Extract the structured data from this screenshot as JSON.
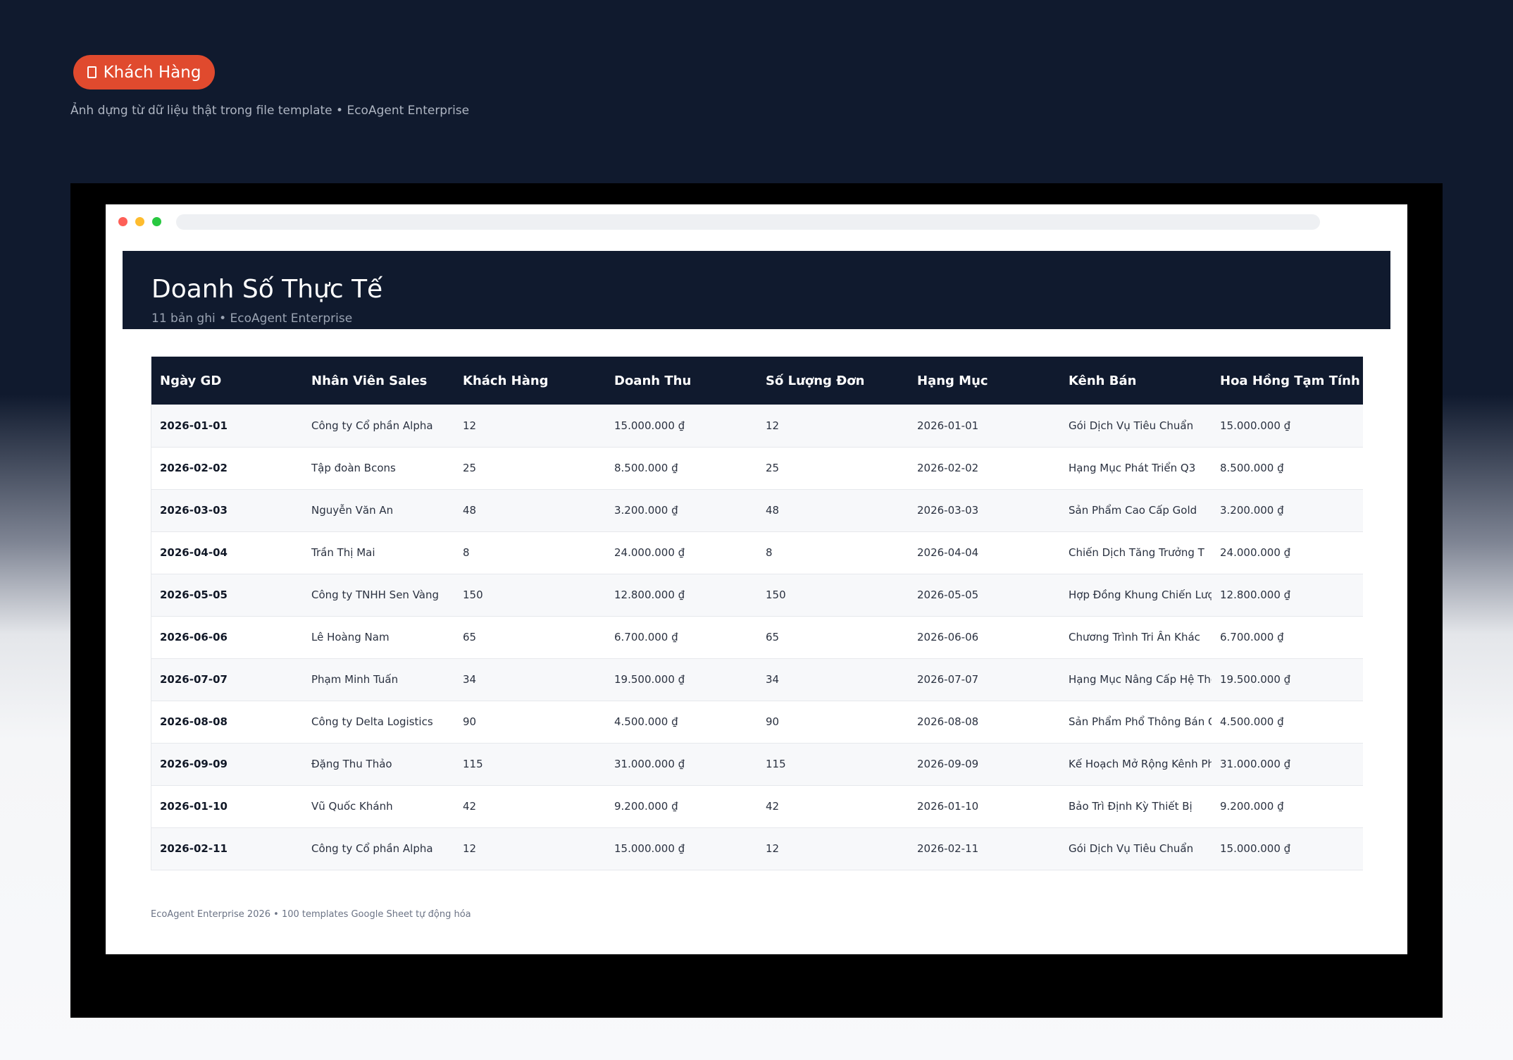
{
  "badge": {
    "icon": "clipboard-icon",
    "label": "Khách Hàng"
  },
  "intro": "Ảnh dựng từ dữ liệu thật trong file template • EcoAgent Enterprise",
  "colors": {
    "navy": "#101a2e",
    "badge": "#e04a2e",
    "dot_red": "#fe5f57",
    "dot_yellow": "#febc2e",
    "dot_green": "#28c840"
  },
  "hero": {
    "title": "Doanh Số Thực Tế",
    "subtitle": "11 bản ghi • EcoAgent Enterprise"
  },
  "table": {
    "columns": [
      "Ngày GD",
      "Nhân Viên Sales",
      "Khách Hàng",
      "Doanh Thu",
      "Số Lượng Đơn",
      "Hạng Mục",
      "Kênh Bán",
      "Hoa Hồng Tạm Tính"
    ],
    "rows": [
      [
        "2026-01-01",
        "Công ty Cổ phần Alpha",
        "12",
        "15.000.000 ₫",
        "12",
        "2026-01-01",
        "Gói Dịch Vụ Tiêu Chuẩn",
        "15.000.000 ₫"
      ],
      [
        "2026-02-02",
        "Tập đoàn Bcons",
        "25",
        "8.500.000 ₫",
        "25",
        "2026-02-02",
        "Hạng Mục Phát Triển Q3",
        "8.500.000 ₫"
      ],
      [
        "2026-03-03",
        "Nguyễn Văn An",
        "48",
        "3.200.000 ₫",
        "48",
        "2026-03-03",
        "Sản Phẩm Cao Cấp Gold",
        "3.200.000 ₫"
      ],
      [
        "2026-04-04",
        "Trần Thị Mai",
        "8",
        "24.000.000 ₫",
        "8",
        "2026-04-04",
        "Chiến Dịch Tăng Trưởng T",
        "24.000.000 ₫"
      ],
      [
        "2026-05-05",
        "Công ty TNHH Sen Vàng",
        "150",
        "12.800.000 ₫",
        "150",
        "2026-05-05",
        "Hợp Đồng Khung Chiến Lượ",
        "12.800.000 ₫"
      ],
      [
        "2026-06-06",
        "Lê Hoàng Nam",
        "65",
        "6.700.000 ₫",
        "65",
        "2026-06-06",
        "Chương Trình Tri Ân Khác",
        "6.700.000 ₫"
      ],
      [
        "2026-07-07",
        "Phạm Minh Tuấn",
        "34",
        "19.500.000 ₫",
        "34",
        "2026-07-07",
        "Hạng Mục Nâng Cấp Hệ Thố",
        "19.500.000 ₫"
      ],
      [
        "2026-08-08",
        "Công ty Delta Logistics",
        "90",
        "4.500.000 ₫",
        "90",
        "2026-08-08",
        "Sản Phẩm Phổ Thông Bán C",
        "4.500.000 ₫"
      ],
      [
        "2026-09-09",
        "Đặng Thu Thảo",
        "115",
        "31.000.000 ₫",
        "115",
        "2026-09-09",
        "Kế Hoạch Mở Rộng Kênh Ph",
        "31.000.000 ₫"
      ],
      [
        "2026-01-10",
        "Vũ Quốc Khánh",
        "42",
        "9.200.000 ₫",
        "42",
        "2026-01-10",
        "Bảo Trì Định Kỳ Thiết Bị",
        "9.200.000 ₫"
      ],
      [
        "2026-02-11",
        "Công ty Cổ phần Alpha",
        "12",
        "15.000.000 ₫",
        "12",
        "2026-02-11",
        "Gói Dịch Vụ Tiêu Chuẩn",
        "15.000.000 ₫"
      ]
    ]
  },
  "footer": "EcoAgent Enterprise 2026 • 100 templates Google Sheet tự động hóa"
}
